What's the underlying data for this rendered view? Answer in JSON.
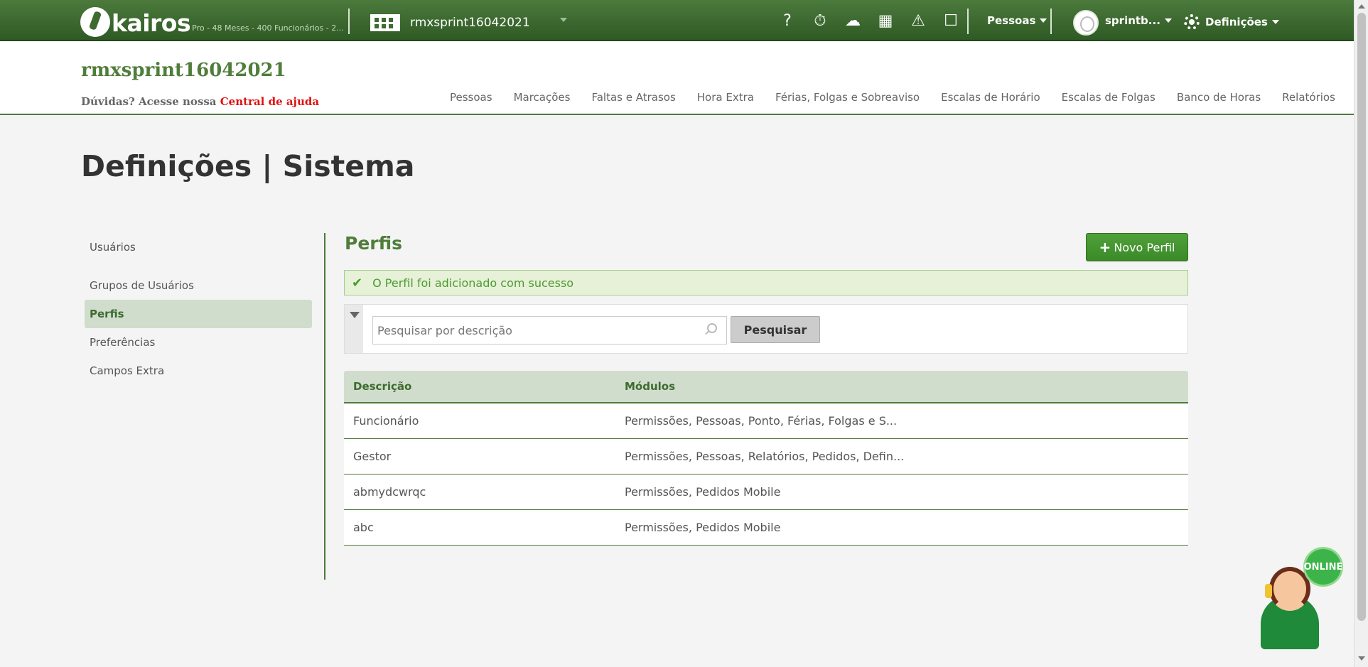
{
  "topbar": {
    "logo_text": "kairos",
    "plan_info": "Pro - 48 Meses - 400 Funcionários - 2...",
    "company_selector": "rmxsprint16042021",
    "tools": [
      {
        "icon": "help-icon",
        "glyph": "?"
      },
      {
        "icon": "clock-check-icon",
        "glyph": "⏱"
      },
      {
        "icon": "cloud-download-icon",
        "glyph": "☁"
      },
      {
        "icon": "calculator-icon",
        "glyph": "▦"
      },
      {
        "icon": "warning-icon",
        "glyph": "⚠"
      },
      {
        "icon": "inbox-icon",
        "glyph": "☐"
      }
    ],
    "people_menu": "Pessoas",
    "user_menu": "sprintb...",
    "settings_menu": "Definições"
  },
  "header": {
    "company_title": "rmxsprint16042021",
    "help_prefix": "Dúvidas? Acesse nossa",
    "help_link": "Central de ajuda",
    "nav": [
      "Pessoas",
      "Marcações",
      "Faltas e Atrasos",
      "Hora Extra",
      "Férias, Folgas e Sobreaviso",
      "Escalas de Horário",
      "Escalas de Folgas",
      "Banco de Horas",
      "Relatórios"
    ]
  },
  "page": {
    "title": "Definições | Sistema"
  },
  "sidebar": {
    "items": [
      {
        "label": "Usuários",
        "active": false
      },
      {
        "label": "Grupos de Usuários",
        "active": false
      },
      {
        "label": "Perfis",
        "active": true
      },
      {
        "label": "Preferências",
        "active": false
      },
      {
        "label": "Campos Extra",
        "active": false
      }
    ]
  },
  "main": {
    "section_title": "Perfis",
    "new_button": "Novo Perfil",
    "alert": "O Perfil foi adicionado com sucesso",
    "search": {
      "placeholder": "Pesquisar por descrição",
      "value": "",
      "button": "Pesquisar"
    },
    "table": {
      "headers": [
        "Descrição",
        "Módulos"
      ],
      "rows": [
        [
          "Funcionário",
          "Permissões, Pessoas, Ponto, Férias, Folgas e S..."
        ],
        [
          "Gestor",
          "Permissões, Pessoas, Relatórios, Pedidos, Defin..."
        ],
        [
          "abmydcwrqc",
          "Permissões, Pedidos Mobile"
        ],
        [
          "abc",
          "Permissões, Pedidos Mobile"
        ]
      ]
    }
  },
  "chat": {
    "status": "ONLINE"
  },
  "colors": {
    "brand_green": "#3d6b2f",
    "accent_red": "#e01010",
    "button_green": "#3a8a28"
  }
}
